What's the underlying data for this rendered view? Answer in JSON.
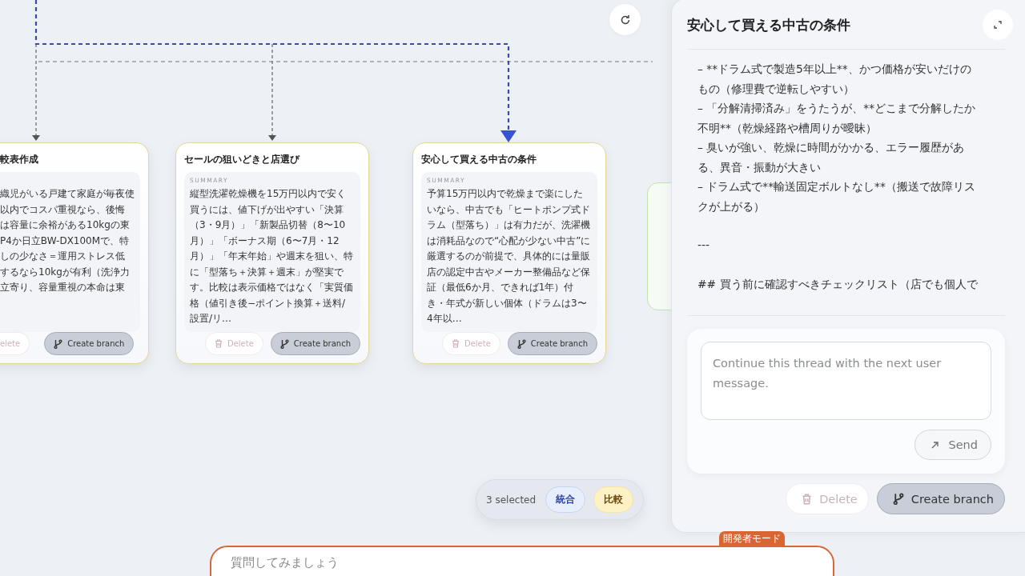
{
  "canvas": {
    "refresh_button": true,
    "cards": [
      {
        "title": "較表作成",
        "summary_lines": [
          "織児がいる戸建て家庭が毎夜使",
          "以内でコスパ重視なら、後悔",
          "は容量に余裕がある10kgの東",
          "P4か日立BW-DX100Mで、特",
          "しの少なさ＝運用ストレス低",
          "するなら10kgが有利（洗浄力",
          "立寄り、容量重視の本命は東"
        ],
        "delete_label": "elete",
        "branch_label": "Create branch",
        "selected": true,
        "cut": true
      },
      {
        "title": "セールの狙いどきと店選び",
        "summary_label": "SUMMARY",
        "summary": "縦型洗濯乾燥機を15万円以内で安く買うには、値下げが出やすい「決算（3・9月）」「新製品切替（8〜10月）」「ボーナス期（6〜7月・12月）」「年末年始」や週末を狙い、特に「型落ち＋決算＋週末」が堅実です。比較は表示価格ではなく「実質価格（値引き後−ポイント換算＋送料/設置/リ…",
        "delete_label": "Delete",
        "branch_label": "Create branch",
        "selected": true,
        "cut": false
      },
      {
        "title": "安心して買える中古の条件",
        "summary_label": "SUMMARY",
        "summary": "予算15万円以内で乾燥まで楽にしたいなら、中古でも「ヒートポンプ式ドラム（型落ち）」は有力だが、洗濯機は消耗品なので“心配が少ない中古”に厳選するのが前提で、具体的には量販店の認定中古やメーカー整備品など保証（最低6か月、できれば1年）付き・年式が新しい個体（ドラムは3〜4年以…",
        "delete_label": "Delete",
        "branch_label": "Create branch",
        "selected": true,
        "cut": false
      }
    ]
  },
  "selection_bar": {
    "count": "3 selected",
    "actions": [
      {
        "label": "統合",
        "kind": "merge"
      },
      {
        "label": "比較",
        "kind": "compare"
      }
    ]
  },
  "panel": {
    "title": "安心して買える中古の条件",
    "content": [
      {
        "kind": "para",
        "text": "–  **ドラム式で製造5年以上**、かつ価格が安いだけのもの（修理費で逆転しやすい）"
      },
      {
        "kind": "para",
        "text": "–  「分解清掃済み」をうたうが、**どこまで分解したか不明**（乾燥経路や槽周りが曖昧）"
      },
      {
        "kind": "para",
        "text": "–  臭いが強い、乾燥に時間がかかる、エラー履歴がある、異音・振動が大きい"
      },
      {
        "kind": "para",
        "text": "–  ドラム式で**輸送固定ボルトなし**（搬送で故障リスクが上がる）"
      },
      {
        "kind": "rule",
        "text": "---"
      },
      {
        "kind": "heading",
        "text": "##  買う前に確認すべきチェックリスト（店でも個人で"
      }
    ],
    "composer": {
      "placeholder": "Continue this thread with the next user message.",
      "send_label": "Send"
    },
    "delete_label": "Delete",
    "branch_label": "Create branch"
  },
  "prompt": {
    "placeholder": "質問してみましょう",
    "badge": "開発者モード"
  }
}
